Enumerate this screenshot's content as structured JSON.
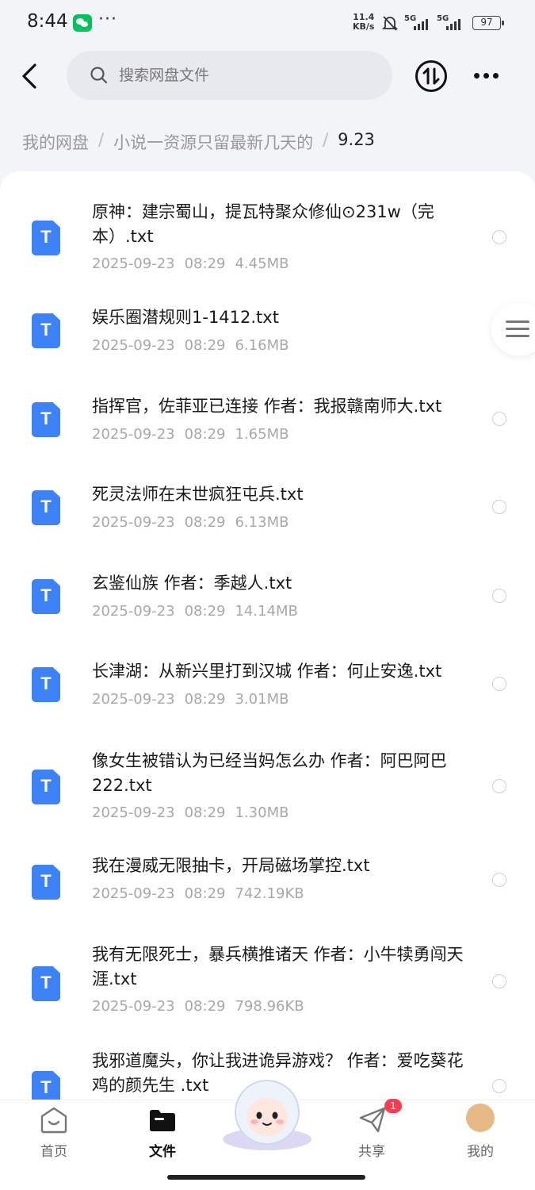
{
  "status_bar": {
    "time": "8:44",
    "net_speed_value": "11.4",
    "net_speed_unit": "KB/s",
    "signal1": "5G",
    "signal2": "5G",
    "battery": "97"
  },
  "header": {
    "search_placeholder": "搜索网盘文件"
  },
  "breadcrumb": {
    "items": [
      "我的网盘",
      "小说一资源只留最新几天的",
      "9.23"
    ],
    "separator": "/"
  },
  "files": [
    {
      "name": "原神：建宗蜀山，提瓦特聚众修仙⊙231w（完本）.txt",
      "date": "2025-09-23",
      "time": "08:29",
      "size": "4.45MB"
    },
    {
      "name": "娱乐圈潜规则1-1412.txt",
      "date": "2025-09-23",
      "time": "08:29",
      "size": "6.16MB"
    },
    {
      "name": "指挥官，佐菲亚已连接 作者：我报赣南师大.txt",
      "date": "2025-09-23",
      "time": "08:29",
      "size": "1.65MB"
    },
    {
      "name": "死灵法师在末世疯狂屯兵.txt",
      "date": "2025-09-23",
      "time": "08:29",
      "size": "6.13MB"
    },
    {
      "name": "玄鉴仙族 作者：季越人.txt",
      "date": "2025-09-23",
      "time": "08:29",
      "size": "14.14MB"
    },
    {
      "name": "长津湖：从新兴里打到汉城 作者：何止安逸.txt",
      "date": "2025-09-23",
      "time": "08:29",
      "size": "3.01MB"
    },
    {
      "name": "像女生被错认为已经当妈怎么办 作者：阿巴阿巴222.txt",
      "date": "2025-09-23",
      "time": "08:29",
      "size": "1.30MB"
    },
    {
      "name": "我在漫威无限抽卡，开局磁场掌控.txt",
      "date": "2025-09-23",
      "time": "08:29",
      "size": "742.19KB"
    },
    {
      "name": "我有无限死士，暴兵横推诸天 作者：小牛犊勇闯天涯.txt",
      "date": "2025-09-23",
      "time": "08:29",
      "size": "798.96KB"
    },
    {
      "name": "我邪道魔头，你让我进诡异游戏？ 作者：爱吃葵花鸡的颜先生 .txt",
      "date": "",
      "time": "",
      "size": ""
    }
  ],
  "bottom_nav": {
    "home": "首页",
    "files": "文件",
    "share": "共享",
    "share_badge": "1",
    "me": "我的"
  },
  "colors": {
    "accent": "#3d82f6",
    "badge": "#ff3b4f",
    "background": "#f3f4f8"
  }
}
